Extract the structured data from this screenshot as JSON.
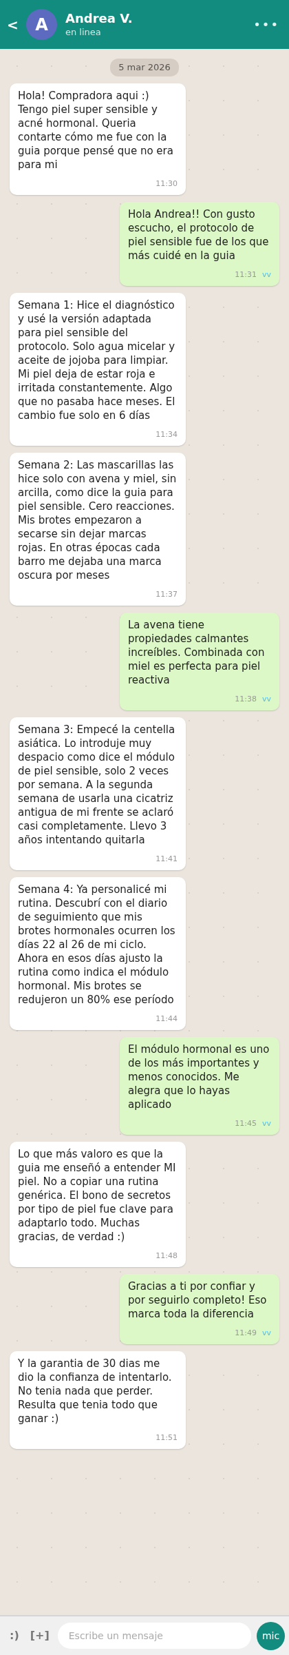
{
  "header": {
    "back": "<",
    "avatar_letter": "A",
    "name": "Andrea V.",
    "status": "en linea",
    "menu": "•••"
  },
  "date": "5 mar 2026",
  "messages": [
    {
      "kind": "incoming",
      "text": "Hola! Compradora aqui :) Tengo piel super sensible y acné hormonal. Queria contarte cómo me fue con la guia porque pensé que no era para mi",
      "time": "11:30"
    },
    {
      "kind": "outgoing",
      "text": "Hola Andrea!! Con gusto escucho, el protocolo de piel sensible fue de los que más cuidé en la guia",
      "time": "11:31",
      "ticks": "vv"
    },
    {
      "kind": "incoming",
      "text": "Semana 1: Hice el diagnóstico y usé la versión adaptada para piel sensible del protocolo. Solo agua micelar y aceite de jojoba para limpiar. Mi piel deja de estar roja e irritada constantemente. Algo que no pasaba hace meses. El cambio fue solo en 6 días",
      "time": "11:34"
    },
    {
      "kind": "incoming",
      "text": "Semana 2: Las mascarillas las hice solo con avena y miel, sin arcilla, como dice la guia para piel sensible. Cero reacciones. Mis brotes empezaron a secarse sin dejar marcas rojas. En otras épocas cada barro me dejaba una marca oscura por meses",
      "time": "11:37"
    },
    {
      "kind": "outgoing",
      "text": "La avena tiene propiedades calmantes increíbles. Combinada con miel es perfecta para piel reactiva",
      "time": "11:38",
      "ticks": "vv"
    },
    {
      "kind": "incoming",
      "text": "Semana 3: Empecé la centella asiática. Lo introduje muy despacio como dice el módulo de piel sensible, solo 2 veces por semana. A la segunda semana de usarla una cicatriz antigua de mi frente se aclaró casi completamente. Llevo 3 años intentando quitarla",
      "time": "11:41"
    },
    {
      "kind": "incoming",
      "text": "Semana 4: Ya personalicé mi rutina. Descubrí con el diario de seguimiento que mis brotes hormonales ocurren los días 22 al 26 de mi ciclo. Ahora en esos días ajusto la rutina como indica el módulo hormonal. Mis brotes se redujeron un 80% ese período",
      "time": "11:44"
    },
    {
      "kind": "outgoing",
      "text": "El módulo hormonal es uno de los más importantes y menos conocidos. Me alegra que lo hayas aplicado",
      "time": "11:45",
      "ticks": "vv"
    },
    {
      "kind": "incoming",
      "text": "Lo que más valoro es que la guia me enseñó a entender MI piel. No a copiar una rutina genérica. El bono de secretos por tipo de piel fue clave para adaptarlo todo. Muchas gracias, de verdad :)",
      "time": "11:48"
    },
    {
      "kind": "outgoing",
      "text": "Gracias a ti por confiar y por seguirlo completo! Eso marca toda la diferencia",
      "time": "11:49",
      "ticks": "vv"
    },
    {
      "kind": "incoming",
      "text": "Y la garantia de 30 dias me dio la confianza de intentarlo. No tenia nada que perder. Resulta que tenia todo que ganar :)",
      "time": "11:51"
    }
  ],
  "composer": {
    "emoji": ":)",
    "attach": "[+]",
    "placeholder": "Escribe un mensaje",
    "mic": "mic"
  }
}
